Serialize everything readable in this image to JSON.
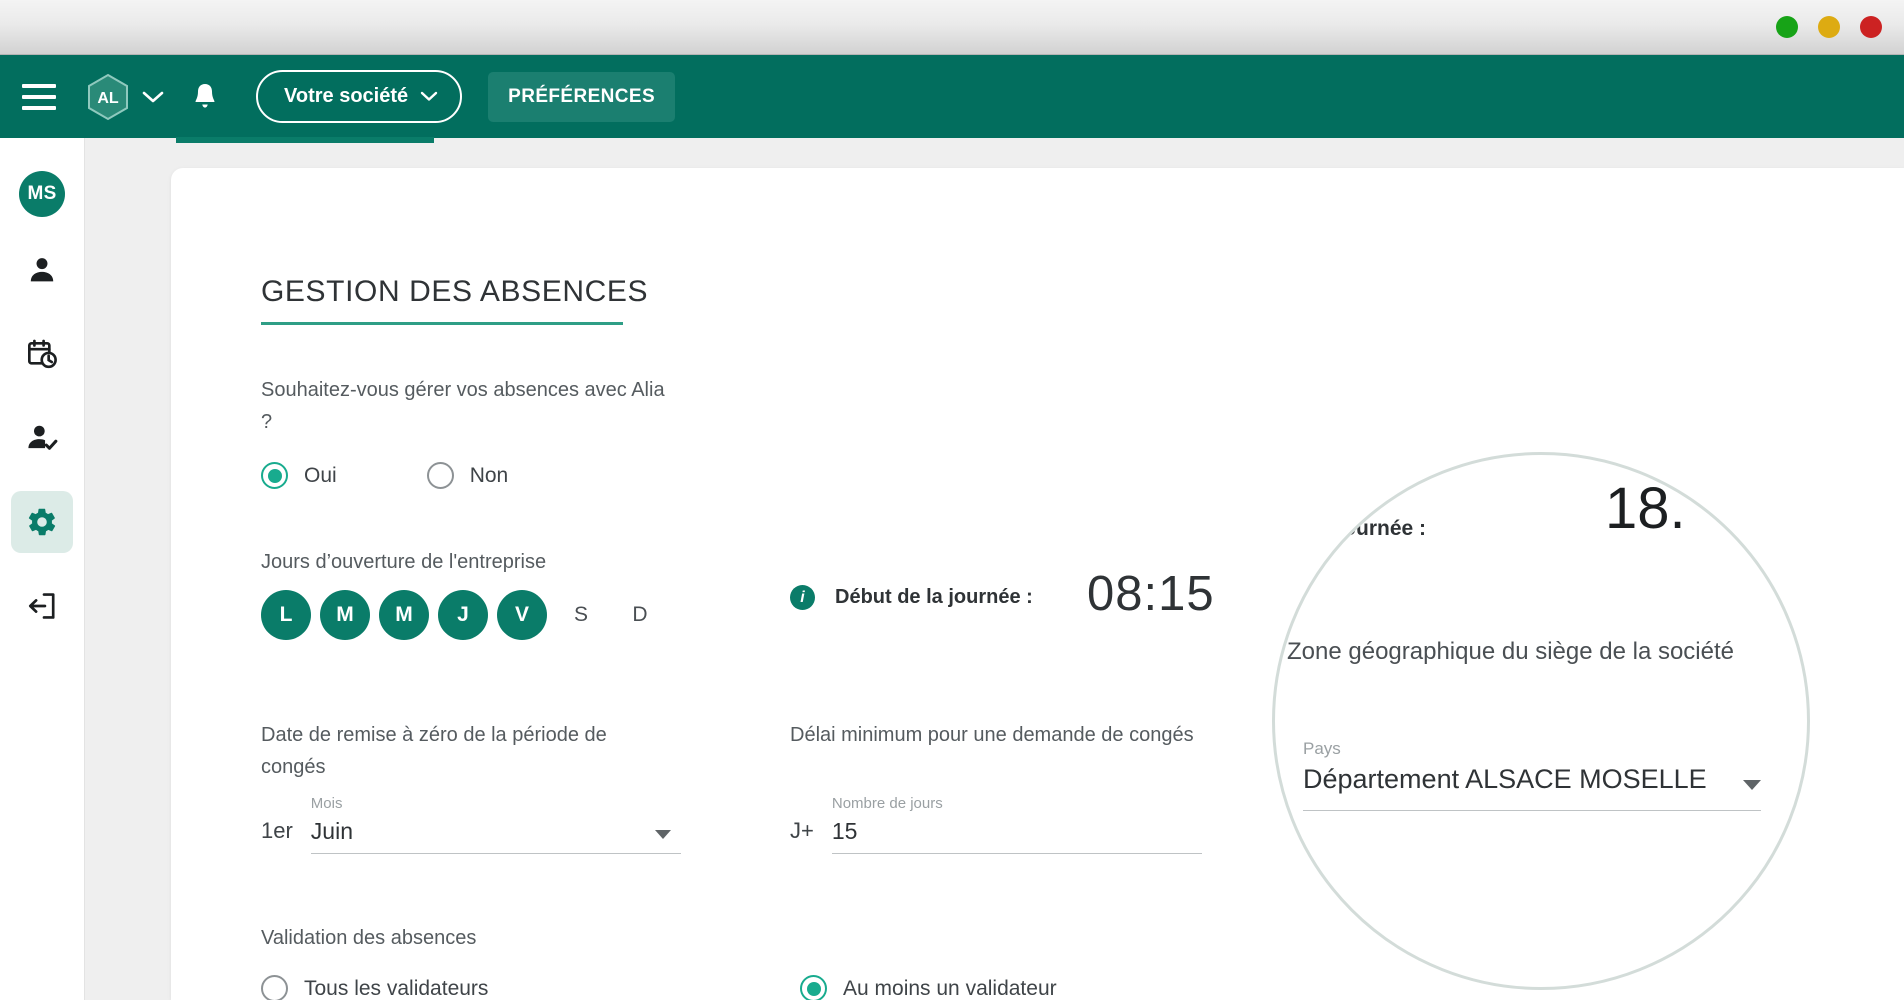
{
  "window": {
    "buttons": [
      {
        "name": "minimize",
        "color": "#17a317"
      },
      {
        "name": "maximize",
        "color": "#ddab12"
      },
      {
        "name": "close",
        "color": "#cc2222"
      }
    ]
  },
  "topnav": {
    "logo_text": "AL",
    "company_label": "Votre société",
    "preferences_label": "PRÉFÉRENCES",
    "background": "#026e5e"
  },
  "sidebar": {
    "avatar_initials": "MS",
    "items": [
      {
        "name": "profile",
        "icon": "person-icon",
        "active": false
      },
      {
        "name": "planning",
        "icon": "calendar-clock-icon",
        "active": false
      },
      {
        "name": "validation",
        "icon": "person-check-icon",
        "active": false
      },
      {
        "name": "settings",
        "icon": "gear-icon",
        "active": true
      },
      {
        "name": "logout",
        "icon": "logout-icon",
        "active": false
      }
    ]
  },
  "main": {
    "title": "GESTION DES ABSENCES",
    "question": "Souhaitez-vous gérer vos absences avec Alia ?",
    "manage_options": [
      {
        "label": "Oui",
        "selected": true
      },
      {
        "label": "Non",
        "selected": false
      }
    ],
    "opening_days_label": "Jours d’ouverture de l'entreprise",
    "days": [
      {
        "label": "L",
        "selected": true
      },
      {
        "label": "M",
        "selected": true
      },
      {
        "label": "M",
        "selected": true
      },
      {
        "label": "J",
        "selected": true
      },
      {
        "label": "V",
        "selected": true
      },
      {
        "label": "S",
        "selected": false
      },
      {
        "label": "D",
        "selected": false
      }
    ],
    "day_start": {
      "icon": "info-icon",
      "label": "Début de la journée :",
      "value": "08:15"
    },
    "reset_date": {
      "label": "Date de remise à zéro de la période de congés",
      "prefix": "1er",
      "field_label": "Mois",
      "value": "Juin"
    },
    "min_delay": {
      "label": "Délai minimum pour une demande de congés",
      "prefix": "J+",
      "field_label": "Nombre de jours",
      "value": "15"
    },
    "validation": {
      "label": "Validation des absences",
      "options": [
        {
          "label": "Tous les validateurs",
          "selected": false
        },
        {
          "label": "Au moins un validateur",
          "selected": true
        }
      ]
    }
  },
  "magnifier": {
    "day_end_label": "n de la journée :",
    "day_end_value": "18.",
    "zone_label": "Zone géographique du siège de la société",
    "country_field_label": "Pays",
    "country_value": "Département ALSACE MOSELLE"
  },
  "colors": {
    "brand_green": "#026e5e",
    "accent_teal": "#0a7c69",
    "radio_teal": "#18ab8e",
    "page_bg": "#efefef"
  }
}
